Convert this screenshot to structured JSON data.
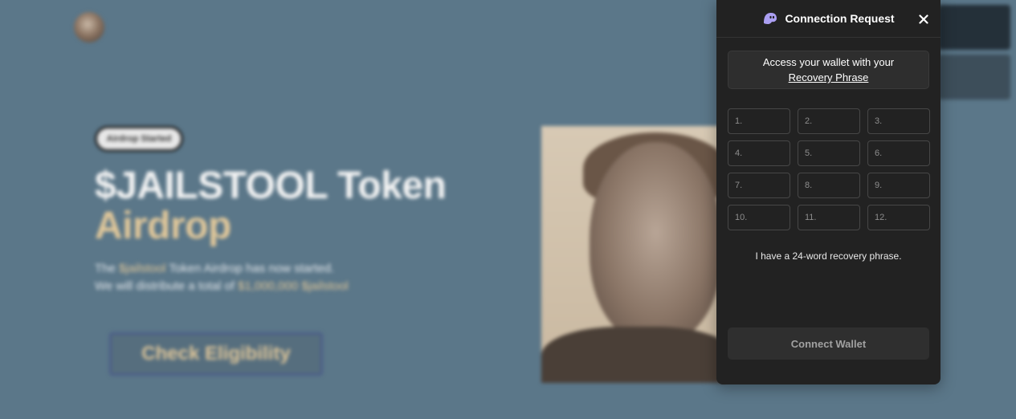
{
  "background": {
    "badge": "Airdrop Started",
    "title_line1": "$JAILSTOOL Token",
    "title_line2": "Airdrop",
    "desc_line1_pre": "The ",
    "desc_line1_token": "$jailstool",
    "desc_line1_post": " Token Airdrop has now started.",
    "desc_line2_pre": "We will distribute a total of ",
    "desc_line2_amount": "$1,000,000",
    "desc_line2_token": " $jailstool",
    "cta_label": "Check Eligibility",
    "accent_color": "#e0c79a"
  },
  "modal": {
    "title": "Connection Request",
    "logo_icon": "ghost-icon",
    "close_icon": "close-icon",
    "info_text": "Access your wallet with your",
    "info_link": "Recovery Phrase",
    "words": [
      {
        "placeholder": "1."
      },
      {
        "placeholder": "2."
      },
      {
        "placeholder": "3."
      },
      {
        "placeholder": "4."
      },
      {
        "placeholder": "5."
      },
      {
        "placeholder": "6."
      },
      {
        "placeholder": "7."
      },
      {
        "placeholder": "8."
      },
      {
        "placeholder": "9."
      },
      {
        "placeholder": "10."
      },
      {
        "placeholder": "11."
      },
      {
        "placeholder": "12."
      }
    ],
    "alt_phrase_link": "I have a 24-word recovery phrase.",
    "connect_label": "Connect Wallet",
    "brand_color": "#ab9ff2",
    "panel_color": "#222222"
  }
}
